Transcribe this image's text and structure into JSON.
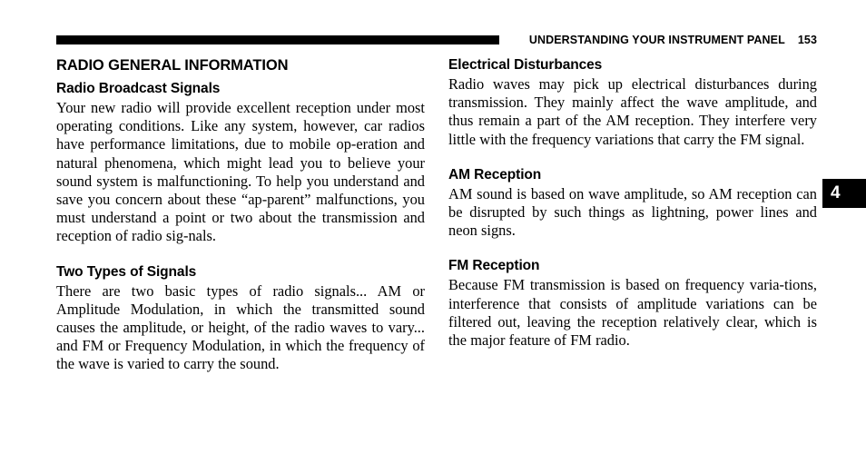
{
  "header": {
    "title": "UNDERSTANDING YOUR INSTRUMENT PANEL",
    "page_number": "153"
  },
  "chapter_tab": {
    "number": "4"
  },
  "left_column": {
    "section_title": "RADIO GENERAL INFORMATION",
    "subsections": [
      {
        "heading": "Radio Broadcast Signals",
        "body": "Your new radio will provide excellent reception under most operating conditions. Like any system, however, car radios have performance limitations, due to mobile op‐eration and natural phenomena, which might lead you to believe your sound system is malfunctioning. To help you understand and save you concern about these “ap‐parent” malfunctions, you must understand a point or two about the transmission and reception of radio sig‐nals."
      },
      {
        "heading": "Two Types of Signals",
        "body": "There are two basic types of radio signals... AM or Amplitude Modulation, in which the transmitted sound causes the amplitude, or height, of the radio waves to vary... and FM or Frequency Modulation, in which the frequency of the wave is varied to carry the sound."
      }
    ]
  },
  "right_column": {
    "subsections": [
      {
        "heading": "Electrical Disturbances",
        "body": "Radio waves may pick up electrical disturbances during transmission. They mainly affect the wave amplitude, and thus remain a part of the AM reception. They interfere very little with the frequency variations that carry the FM signal."
      },
      {
        "heading": "AM Reception",
        "body": "AM sound is based on wave amplitude, so AM reception can be disrupted by such things as lightning, power lines and neon signs."
      },
      {
        "heading": "FM Reception",
        "body": "Because FM transmission is based on frequency varia‐tions, interference that consists of amplitude variations can be filtered out, leaving the reception relatively clear, which is the major feature of FM radio."
      }
    ]
  }
}
